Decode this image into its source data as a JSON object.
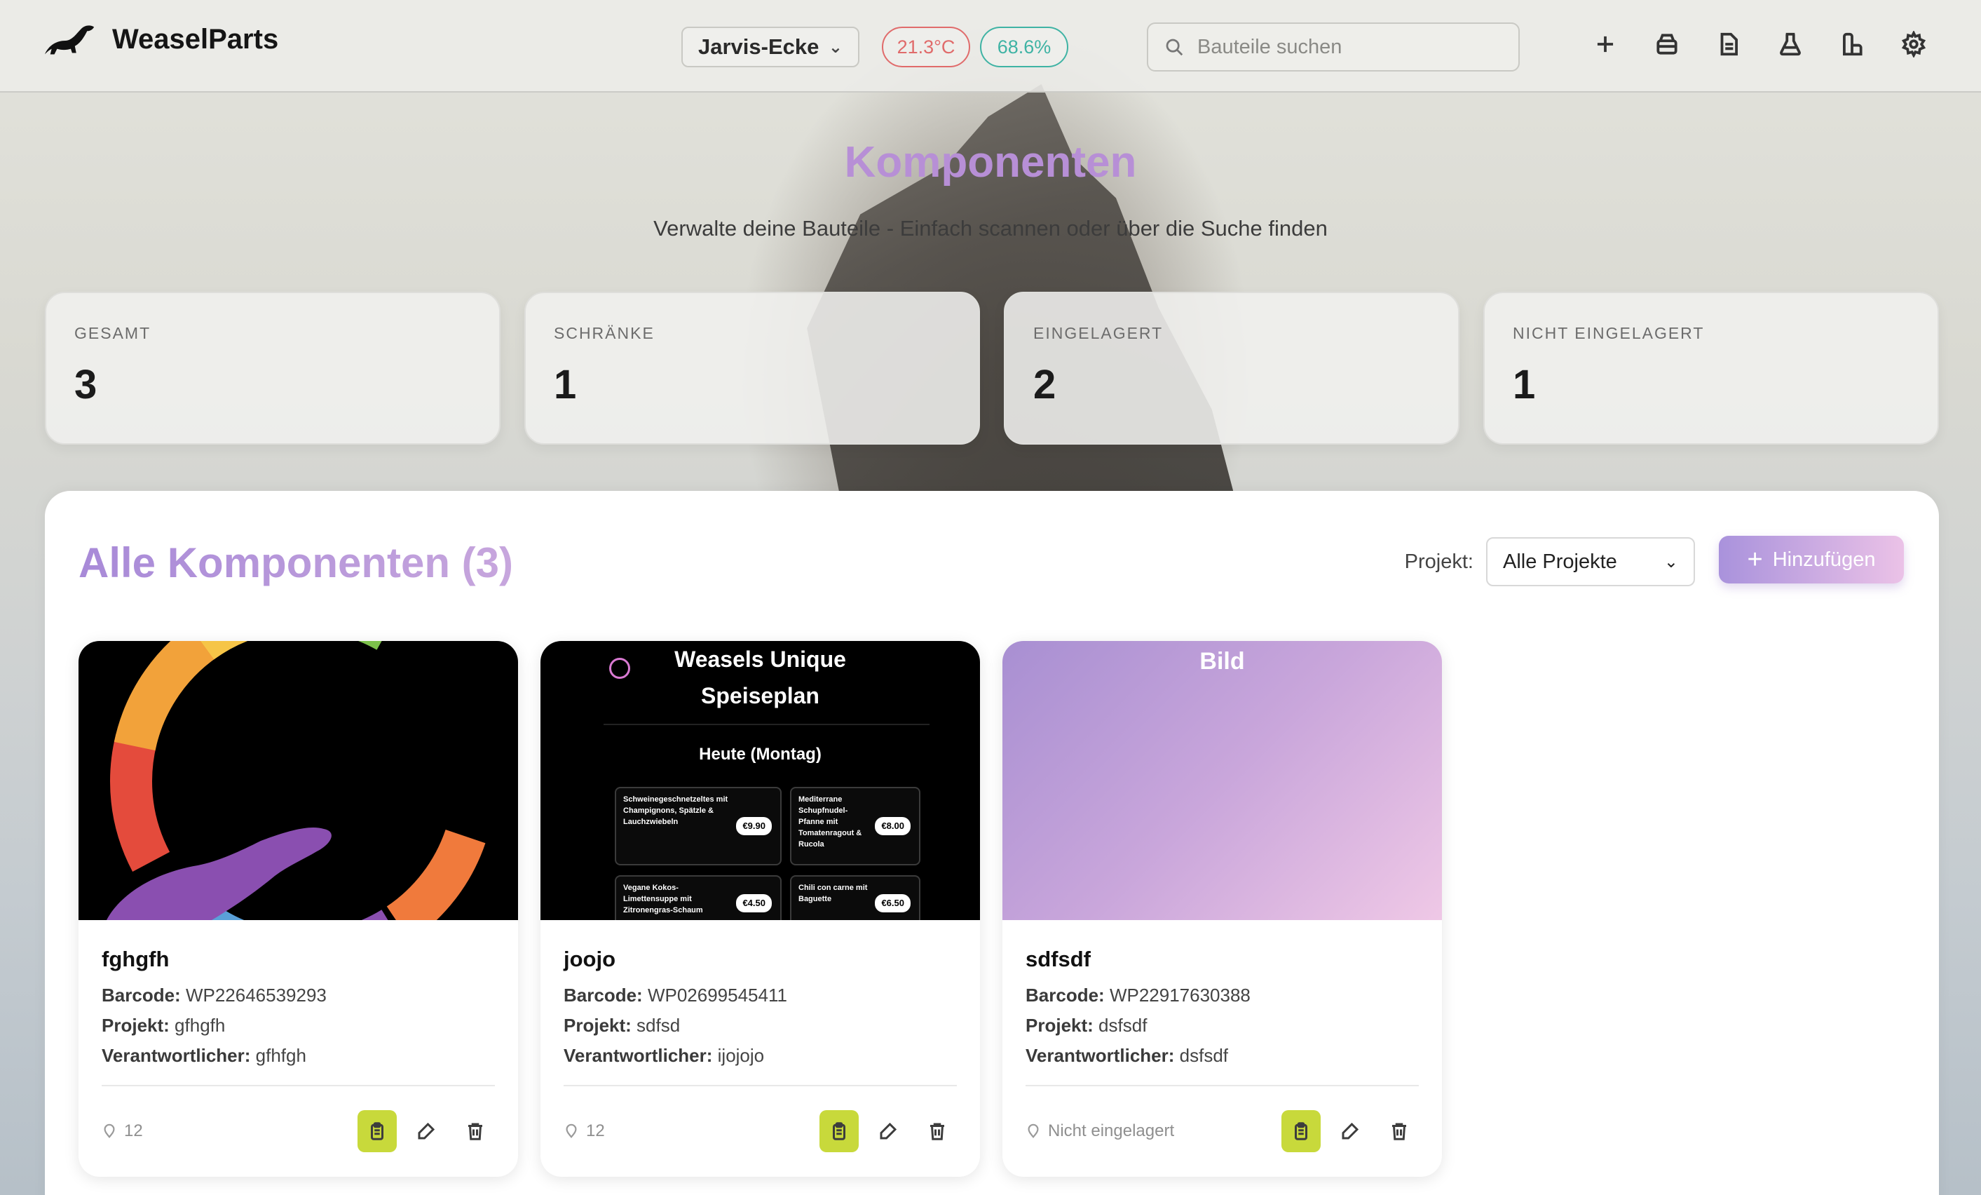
{
  "app": {
    "name": "WeaselParts"
  },
  "header": {
    "location": "Jarvis-Ecke",
    "temperature": "21.3°C",
    "humidity": "68.6%",
    "search_placeholder": "Bauteile suchen",
    "icons": [
      "plus-icon",
      "cabinet-icon",
      "document-icon",
      "flask-icon",
      "layout-icon",
      "gear-icon"
    ]
  },
  "hero": {
    "title": "Komponenten",
    "subtitle": "Verwalte deine Bauteile - Einfach scannen oder über die Suche finden"
  },
  "stats": [
    {
      "label": "GESAMT",
      "value": "3"
    },
    {
      "label": "SCHRÄNKE",
      "value": "1"
    },
    {
      "label": "EINGELAGERT",
      "value": "2"
    },
    {
      "label": "NICHT EINGELAGERT",
      "value": "1"
    }
  ],
  "panel": {
    "title": "Alle Komponenten (3)",
    "filter_label": "Projekt:",
    "filter_value": "Alle Projekte",
    "add_label": "Hinzufügen"
  },
  "labels": {
    "barcode": "Barcode:",
    "project": "Projekt:",
    "owner": "Verantwortlicher:"
  },
  "cards": [
    {
      "name": "fghgfh",
      "barcode": "WP22646539293",
      "project": "gfhgfh",
      "owner": "gfhfgh",
      "location": "12",
      "image": "gear-logo"
    },
    {
      "name": "joojo",
      "barcode": "WP02699545411",
      "project": "sdfsd",
      "owner": "ijojojo",
      "location": "12",
      "image": "menu",
      "menu": {
        "title_line1": "Weasels Unique",
        "title_line2": "Speiseplan",
        "day": "Heute (Montag)",
        "dishes": [
          {
            "name": "Schweinegeschnetzeltes mit Champignons, Spätzle & Lauchzwiebeln",
            "price": "€9.90"
          },
          {
            "name": "Mediterrane Schupfnudel-Pfanne mit Tomatenragout & Rucola",
            "price": "€8.00"
          },
          {
            "name": "Vegane Kokos-Limettensuppe mit Zitronengras-Schaum",
            "price": "€4.50"
          },
          {
            "name": "Chili con carne mit Baguette",
            "price": "€6.50"
          }
        ]
      }
    },
    {
      "name": "sdfsdf",
      "barcode": "WP22917630388",
      "project": "dsfsdf",
      "owner": "dsfsdf",
      "location": "Nicht eingelagert",
      "image": "placeholder",
      "placeholder_text": "Bild"
    }
  ],
  "colors": {
    "accent": "#b78fd6",
    "temp": "#e06b6b",
    "humidity": "#3fb3a4",
    "action": "#c8d93b"
  }
}
